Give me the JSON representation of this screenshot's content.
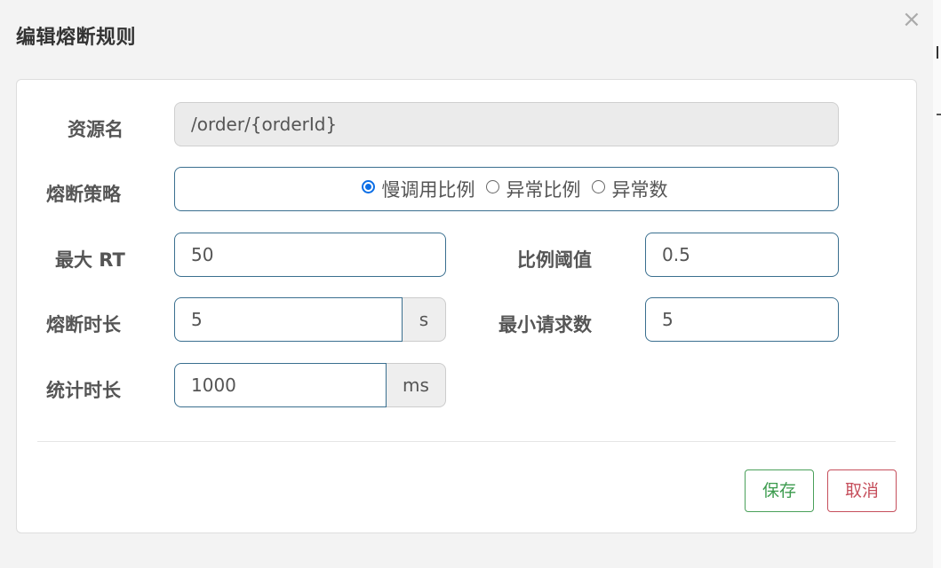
{
  "dialog": {
    "title": "编辑熔断规则",
    "close_symbol": "×"
  },
  "form": {
    "resource": {
      "label": "资源名",
      "value": "/order/{orderId}"
    },
    "strategy": {
      "label": "熔断策略",
      "options": [
        "慢调用比例",
        "异常比例",
        "异常数"
      ],
      "selected": "慢调用比例"
    },
    "max_rt": {
      "label": "最大 RT",
      "value": "50"
    },
    "ratio_threshold": {
      "label": "比例阈值",
      "value": "0.5"
    },
    "break_duration": {
      "label": "熔断时长",
      "value": "5",
      "unit": "s"
    },
    "min_requests": {
      "label": "最小请求数",
      "value": "5"
    },
    "stat_duration": {
      "label": "统计时长",
      "value": "1000",
      "unit": "ms"
    }
  },
  "footer": {
    "save_label": "保存",
    "cancel_label": "取消"
  },
  "colors": {
    "accent_blue": "#0b6ee6",
    "save_green": "#3c9b4e",
    "cancel_red": "#c64f5c",
    "input_border": "#3a6f8f"
  }
}
